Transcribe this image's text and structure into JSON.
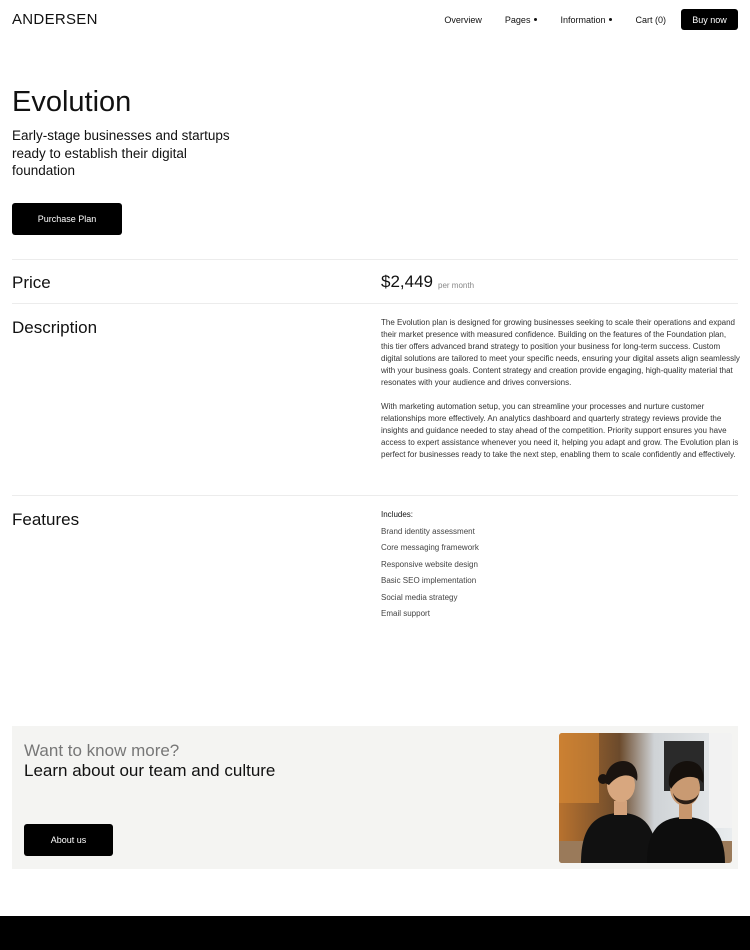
{
  "header": {
    "logo": "ANDERSEN",
    "nav": [
      {
        "label": "Overview",
        "has_dot": false
      },
      {
        "label": "Pages",
        "has_dot": true
      },
      {
        "label": "Information",
        "has_dot": true
      },
      {
        "label": "Cart (0)",
        "has_dot": false
      }
    ],
    "buy_label": "Buy now"
  },
  "hero": {
    "title": "Evolution",
    "subtitle": "Early-stage businesses and startups ready to establish their digital foundation",
    "purchase_label": "Purchase Plan"
  },
  "price": {
    "heading": "Price",
    "amount": "$2,449",
    "period": "per month"
  },
  "description": {
    "heading": "Description",
    "paragraphs": [
      "The Evolution plan is designed for growing businesses seeking to scale their operations and expand their market presence with measured confidence. Building on the features of the Foundation plan, this tier offers advanced brand strategy to position your business for long-term success. Custom digital solutions are tailored to meet your specific needs, ensuring your digital assets align seamlessly with your business goals. Content strategy and creation provide engaging, high-quality material that resonates with your audience and drives conversions.",
      "With marketing automation setup, you can streamline your processes and nurture customer relationships more effectively. An analytics dashboard and quarterly strategy reviews provide the insights and guidance needed to stay ahead of the competition. Priority support ensures you have access to expert assistance whenever you need it, helping you adapt and grow. The Evolution plan is perfect for businesses ready to take the next step, enabling them to scale confidently and effectively."
    ]
  },
  "features": {
    "heading": "Features",
    "includes_label": "Includes:",
    "items": [
      "Brand identity assessment",
      "Core messaging framework",
      "Responsive website design",
      "Basic SEO implementation",
      "Social media strategy",
      "Email support"
    ]
  },
  "cta": {
    "kicker": "Want to know more?",
    "title": "Learn about our team and culture",
    "button_label": "About us"
  },
  "colors": {
    "primary": "#000000",
    "cta_background": "#f4f4f2",
    "muted_text": "#777777"
  }
}
